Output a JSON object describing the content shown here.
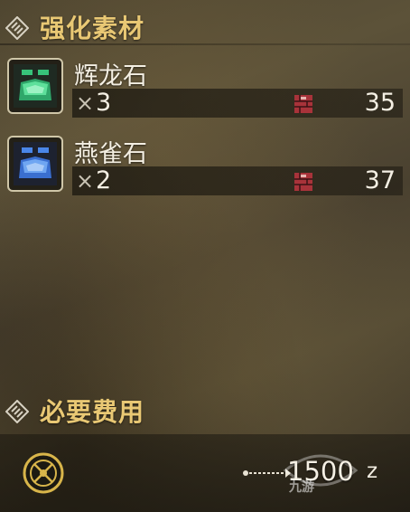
{
  "materials_section": {
    "title": "强化素材",
    "icon": "diamond-ornament-icon"
  },
  "materials": [
    {
      "name": "辉龙石",
      "qty_prefix": "×",
      "qty": "3",
      "owned": "35",
      "color": "#37c27a",
      "icon": "ore-green-icon"
    },
    {
      "name": "燕雀石",
      "qty_prefix": "×",
      "qty": "2",
      "owned": "37",
      "color": "#4a86e8",
      "icon": "ore-blue-icon"
    }
  ],
  "cost_section": {
    "title": "必要费用",
    "icon": "diamond-ornament-icon"
  },
  "cost": {
    "amount": "1500",
    "unit": "z",
    "coin_icon": "zenny-coin-icon",
    "watermark": "九游"
  }
}
